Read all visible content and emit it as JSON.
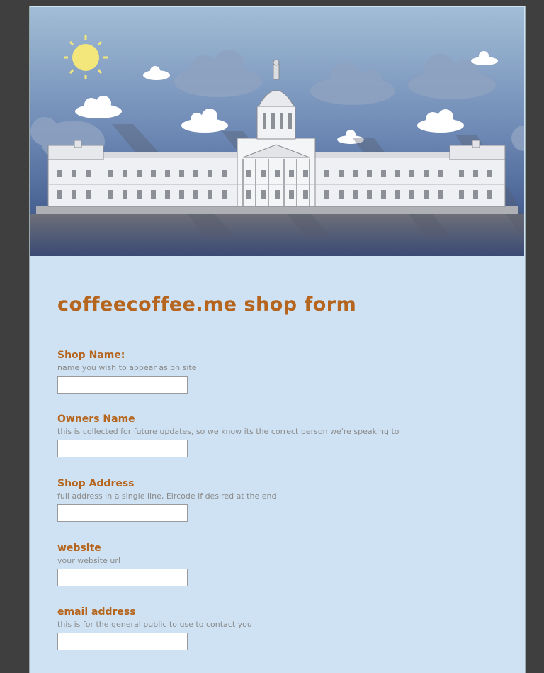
{
  "form": {
    "title": "coffeecoffee.me shop form",
    "fields": [
      {
        "label": "Shop Name:",
        "help": "name you wish to appear as on site",
        "value": ""
      },
      {
        "label": "Owners Name",
        "help": "this is collected for future updates, so we know its the correct person we're speaking to",
        "value": ""
      },
      {
        "label": "Shop Address",
        "help": "full address in a single line, Eircode if desired at the end",
        "value": ""
      },
      {
        "label": "website",
        "help": "your website url",
        "value": ""
      },
      {
        "label": "email address",
        "help": "this is for the general public to use to contact you",
        "value": ""
      }
    ]
  },
  "header": {
    "image": "custom-house-illustration",
    "sky_top": "#9fbad6",
    "sky_bottom": "#4a6494",
    "sun_color": "#f3e67a"
  }
}
